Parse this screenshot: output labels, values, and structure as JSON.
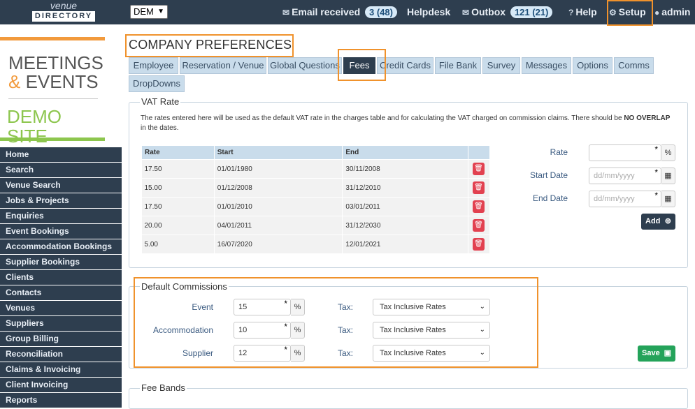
{
  "header": {
    "logo_top": "venue",
    "logo_bottom": "DIRECTORY",
    "site_select": "DEM",
    "email_label": "Email received",
    "email_badge": "3 (48)",
    "helpdesk": "Helpdesk",
    "outbox_label": "Outbox",
    "outbox_badge": "121 (21)",
    "help": "Help",
    "setup": "Setup",
    "user": "admin"
  },
  "brand": {
    "line1": "MEETINGS",
    "amp": "&",
    "line2": " EVENTS",
    "line3": "DEMO SITE"
  },
  "sidebar": {
    "items": [
      "Home",
      "Search",
      "Venue Search",
      "Jobs & Projects",
      "Enquiries",
      "Event Bookings",
      "Accommodation Bookings",
      "Supplier Bookings",
      "Clients",
      "Contacts",
      "Venues",
      "Suppliers",
      "Group Billing",
      "Reconciliation",
      "Claims & Invoicing",
      "Client Invoicing",
      "Reports"
    ]
  },
  "page": {
    "title": "COMPANY PREFERENCES",
    "tabs": [
      "Employee",
      "Reservation / Venue",
      "Global Questions",
      "Fees",
      "Credit Cards",
      "File Bank",
      "Survey",
      "Messages",
      "Options",
      "Comms",
      "DropDowns"
    ],
    "active_tab": "Fees"
  },
  "vat": {
    "legend": "VAT Rate",
    "note_start": "The rates entered here will be used as the default VAT rate in the charges table and for calculating the VAT charged on commission claims. There should be ",
    "note_bold": "NO OVERLAP",
    "note_end": " in the dates.",
    "columns": [
      "Rate",
      "Start",
      "End"
    ],
    "rows": [
      [
        "17.50",
        "01/01/1980",
        "30/11/2008"
      ],
      [
        "15.00",
        "01/12/2008",
        "31/12/2010"
      ],
      [
        "17.50",
        "01/01/2010",
        "03/01/2011"
      ],
      [
        "20.00",
        "04/01/2011",
        "31/12/2030"
      ],
      [
        "5.00",
        "16/07/2020",
        "12/01/2021"
      ]
    ],
    "form": {
      "rate_label": "Rate",
      "start_label": "Start Date",
      "end_label": "End Date",
      "date_placeholder": "dd/mm/yyyy",
      "percent": "%",
      "add_label": "Add"
    }
  },
  "commissions": {
    "legend": "Default Commissions",
    "rows": [
      {
        "label": "Event",
        "value": "15",
        "tax_label": "Tax:",
        "tax": "Tax Inclusive Rates"
      },
      {
        "label": "Accommodation",
        "value": "10",
        "tax_label": "Tax:",
        "tax": "Tax Inclusive Rates"
      },
      {
        "label": "Supplier",
        "value": "12",
        "tax_label": "Tax:",
        "tax": "Tax Inclusive Rates"
      }
    ],
    "percent": "%",
    "save_label": "Save"
  },
  "fee_bands": {
    "legend": "Fee Bands"
  },
  "colors": {
    "nav": "#2e3e4f",
    "highlight": "#f0922c",
    "tab": "#c9dceb",
    "delete": "#e24150",
    "save": "#24a35a"
  }
}
